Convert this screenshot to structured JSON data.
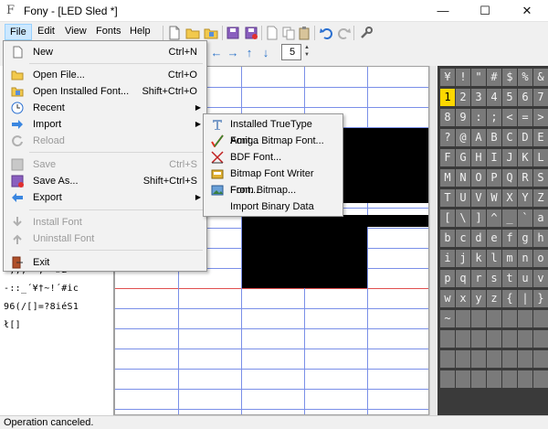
{
  "window": {
    "title": "Fony - [LED Sled *]",
    "app_icon_glyph": "F",
    "minimize_glyph": "—",
    "maximize_glyph": "☐",
    "close_glyph": "✕"
  },
  "menubar": {
    "items": [
      {
        "label": "File"
      },
      {
        "label": "Edit"
      },
      {
        "label": "View"
      },
      {
        "label": "Fonts"
      },
      {
        "label": "Help"
      }
    ]
  },
  "toolbar": {
    "icons": [
      "new-document-icon",
      "open-folder-icon",
      "open-installed-icon",
      "save-icon",
      "save-as-icon",
      "cut-icon",
      "copy-icon",
      "paste-icon",
      "undo-icon",
      "redo-icon",
      "settings-wrench-icon"
    ],
    "arrows": [
      "←",
      "→",
      "↑",
      "↓"
    ],
    "spin_value": "5",
    "spin_up": "▲",
    "spin_down": "▼"
  },
  "file_menu": {
    "items": [
      {
        "label": "New",
        "shortcut": "Ctrl+N",
        "icon": "new-icon"
      },
      {
        "label": "Open File...",
        "shortcut": "Ctrl+O",
        "icon": "open-folder-icon"
      },
      {
        "label": "Open Installed Font...",
        "shortcut": "Shift+Ctrl+O",
        "icon": "installed-font-icon"
      },
      {
        "label": "Recent",
        "shortcut": "",
        "icon": "clock-icon",
        "submenu": true
      },
      {
        "label": "Import",
        "shortcut": "",
        "icon": "import-arrow-icon",
        "submenu": true
      },
      {
        "label": "Reload",
        "shortcut": "",
        "icon": "reload-icon",
        "disabled": true
      },
      {
        "label": "Save",
        "shortcut": "Ctrl+S",
        "icon": "save-icon",
        "disabled": true
      },
      {
        "label": "Save As...",
        "shortcut": "Shift+Ctrl+S",
        "icon": "save-as-icon"
      },
      {
        "label": "Export",
        "shortcut": "",
        "icon": "export-arrow-icon",
        "submenu": true
      },
      {
        "label": "Install Font",
        "shortcut": "",
        "icon": "install-icon",
        "disabled": true
      },
      {
        "label": "Uninstall Font",
        "shortcut": "",
        "icon": "uninstall-icon",
        "disabled": true
      },
      {
        "label": "Exit",
        "shortcut": "",
        "icon": "exit-icon"
      }
    ],
    "submenu_glyph": "▶"
  },
  "import_submenu": {
    "items": [
      {
        "label": "Installed TrueType Font...",
        "icon": "truetype-icon"
      },
      {
        "label": "Amiga Bitmap Font...",
        "icon": "amiga-icon"
      },
      {
        "label": "BDF Font...",
        "icon": "bdf-icon"
      },
      {
        "label": "Bitmap Font Writer Font...",
        "icon": "bitmap-font-writer-icon"
      },
      {
        "label": "From Bitmap...",
        "icon": "from-bitmap-icon"
      },
      {
        "label": "Import Binary Data",
        "icon": ""
      }
    ]
  },
  "preview": {
    "lines": [
      "~,,,\"‾, ~#£‾´",
      "-::_´¥†~!´#ic",
      "96(/[]=?8iéS1",
      "ł[]"
    ]
  },
  "glyph_grid": {
    "rows": [
      [
        "¥",
        "!",
        "\"",
        "#",
        "$",
        "%",
        "&"
      ],
      [
        "'",
        "2",
        "3",
        "4",
        "5",
        "6",
        "7"
      ],
      [
        "8",
        "9",
        ":",
        ";",
        "<",
        "=",
        ">"
      ],
      [
        "?",
        "@",
        "A",
        "B",
        "C",
        "D",
        "E"
      ],
      [
        "F",
        "G",
        "H",
        "I",
        "J",
        "K",
        "L"
      ],
      [
        "M",
        "N",
        "O",
        "P",
        "Q",
        "R",
        "S"
      ],
      [
        "T",
        "U",
        "V",
        "W",
        "X",
        "Y",
        "Z"
      ],
      [
        "[",
        "\\",
        "]",
        "^",
        "_",
        "`",
        "a"
      ],
      [
        "b",
        "c",
        "d",
        "e",
        "f",
        "g",
        "h"
      ],
      [
        "i",
        "j",
        "k",
        "l",
        "m",
        "n",
        "o"
      ],
      [
        "p",
        "q",
        "r",
        "s",
        "t",
        "u",
        "v"
      ],
      [
        "w",
        "x",
        "y",
        "z",
        "{",
        "|",
        "}"
      ],
      [
        "~",
        "",
        "",
        "",
        "",
        "",
        ""
      ],
      [
        "",
        "",
        "",
        "",
        "",
        "",
        ""
      ],
      [
        "",
        "",
        "",
        "",
        "",
        "",
        ""
      ],
      [
        "",
        "",
        "",
        "",
        "",
        "",
        ""
      ]
    ],
    "selected": "1",
    "selected_row": 1,
    "selected_col": 0
  },
  "status": {
    "text": "Operation canceled."
  },
  "colors": {
    "grid_line": "#7a8fe8",
    "baseline": "#e05050",
    "pixel_on": "#000000",
    "glyph_cell": "#7a7a7a",
    "glyph_selected": "#ffd800",
    "menu_highlight": "#cce8ff"
  }
}
